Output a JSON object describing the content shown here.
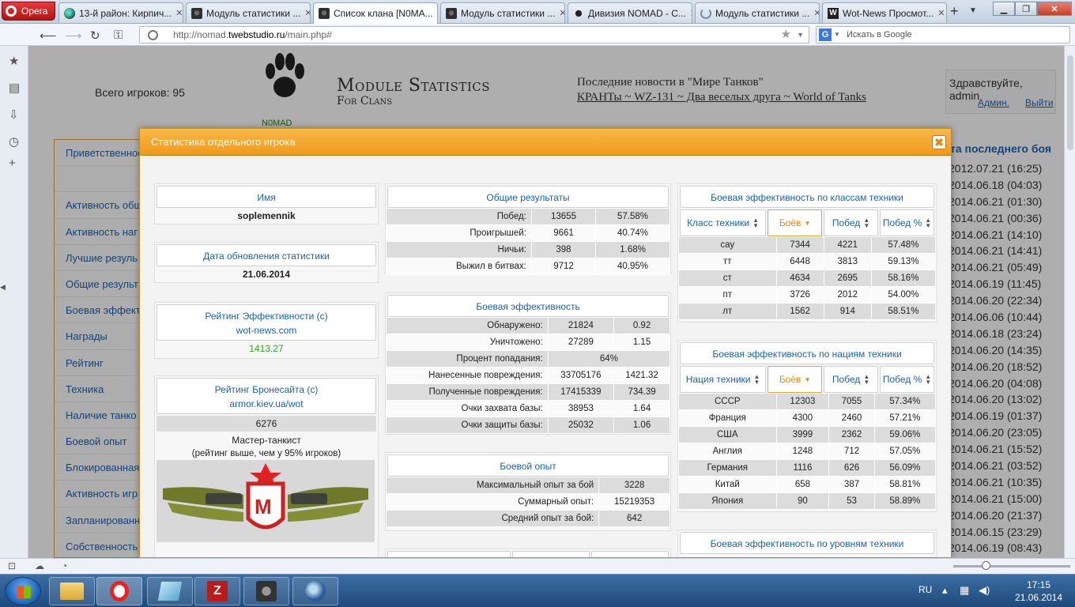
{
  "browser": {
    "menu_label": "Opera",
    "tabs": [
      {
        "title": "13-й район: Кирпич...",
        "icon": "globe-icon"
      },
      {
        "title": "Модуль статистики ...",
        "icon": "wot-icon"
      },
      {
        "title": "Список клана [N0MA...",
        "icon": "wot-icon",
        "active": true
      },
      {
        "title": "Модуль статистики ...",
        "icon": "wot-icon"
      },
      {
        "title": "Дивизия NOMAD - С...",
        "icon": "paw-icon"
      },
      {
        "title": "Модуль статистики ...",
        "icon": "loading-icon"
      },
      {
        "title": "Wot-News Просмот...",
        "icon": "w-icon"
      }
    ],
    "url_prefix": "http://nomad.",
    "url_domain": "twebstudio.ru",
    "url_path": "/main.php#",
    "search_placeholder": "Искать в Google",
    "search_engine": "G"
  },
  "page": {
    "players_total": "Всего игроков: 95",
    "logo_name": "N0MAD",
    "logo_title": "Module Statistics",
    "logo_sub": "For Clans",
    "news_heading": "Последние новости в \"Мире Танков\"",
    "news_links": "КРАНТы ~ WZ-131 ~ Два веселых друга ~ World of Tanks",
    "greeting": "Здравствуйте, admin",
    "admin_link": "Админ.",
    "logout_link": "Выйти",
    "last_battle_header": "та последнего боя",
    "menu": [
      "Приветственное",
      "",
      "Активность общ",
      "Активность наг",
      "Лучшие резуль",
      "Общие результ",
      "Боевая эффект",
      "Награды",
      "Рейтинг",
      "Техника",
      "Наличие танко",
      "Боевой опыт",
      "Блокированная",
      "Активность игр",
      "Запланированн",
      "Собственность"
    ],
    "dates": [
      "2012.07.21 (16:25)",
      "2014.06.18 (04:03)",
      "2014.06.21 (01:30)",
      "2014.06.21 (00:36)",
      "2014.06.21 (14:10)",
      "2014.06.21 (14:41)",
      "2014.06.21 (05:49)",
      "2014.06.19 (11:45)",
      "2014.06.20 (22:34)",
      "2014.06.06 (10:44)",
      "2014.06.18 (23:24)",
      "2014.06.20 (14:35)",
      "2014.06.20 (18:52)",
      "2014.06.20 (04:08)",
      "2014.06.20 (13:02)",
      "2014.06.19 (01:37)",
      "2014.06.20 (23:05)",
      "2014.06.21 (15:52)",
      "2014.06.21 (03:52)",
      "2014.06.21 (10:35)",
      "2014.06.21 (15:00)",
      "2014.06.20 (21:37)",
      "2014.06.15 (23:29)",
      "2014.06.19 (08:43)"
    ]
  },
  "modal": {
    "title": "Статистика отдельного игрока",
    "close_label": "✖",
    "name_header": "Имя",
    "name_value": "soplemennik",
    "updated_header": "Дата обновления статистики",
    "updated_value": "21.06.2014",
    "eff_rating_header": "Рейтинг Эффективности (с)",
    "eff_rating_link": "wot-news.com",
    "eff_rating_value": "1413.27",
    "armor_header": "Рейтинг Бронесайта (с)",
    "armor_link": "armor.kiev.ua/wot",
    "armor_value": "6276",
    "armor_title": "Мастер-танкист",
    "armor_note": "(рейтинг выше, чем у 95% игроков)",
    "medal_letter": "М",
    "general": {
      "header": "Общие результаты",
      "rows": [
        [
          "Побед:",
          "13655",
          "57.58%"
        ],
        [
          "Проигрышей:",
          "9661",
          "40.74%"
        ],
        [
          "Ничьи:",
          "398",
          "1.68%"
        ],
        [
          "Выжил в битвах:",
          "9712",
          "40.95%"
        ]
      ]
    },
    "battle_eff": {
      "header": "Боевая эффективность",
      "rows": [
        [
          "Обнаружено:",
          "21824",
          "0.92"
        ],
        [
          "Уничтожено:",
          "27289",
          "1.15"
        ],
        [
          "Процент попадания:",
          "64%",
          ""
        ],
        [
          "Нанесенные повреждения:",
          "33705176",
          "1421.32"
        ],
        [
          "Полученные повреждения:",
          "17415339",
          "734.39"
        ],
        [
          "Очки захвата базы:",
          "38953",
          "1.64"
        ],
        [
          "Очки защиты базы:",
          "25032",
          "1.06"
        ]
      ]
    },
    "experience": {
      "header": "Боевой опыт",
      "rows": [
        [
          "Максимальный опыт за бой",
          "3228"
        ],
        [
          "Суммарный опыт:",
          "15219353"
        ],
        [
          "Средний опыт за бой:",
          "642"
        ]
      ]
    },
    "rating_cols": [
      "Рейтинг",
      "Значение",
      "Место"
    ],
    "by_class": {
      "header": "Боевая эффективность по классам техники",
      "cols": [
        "Класс техники",
        "Боёв",
        "Побед",
        "Побед %"
      ],
      "rows": [
        [
          "сау",
          "7344",
          "4221",
          "57.48%"
        ],
        [
          "тт",
          "6448",
          "3813",
          "59.13%"
        ],
        [
          "ст",
          "4634",
          "2695",
          "58.16%"
        ],
        [
          "пт",
          "3726",
          "2012",
          "54.00%"
        ],
        [
          "лт",
          "1562",
          "914",
          "58.51%"
        ]
      ]
    },
    "by_nation": {
      "header": "Боевая эффективность по нациям техники",
      "cols": [
        "Нация техники",
        "Боёв",
        "Побед",
        "Побед %"
      ],
      "rows": [
        [
          "СССР",
          "12303",
          "7055",
          "57.34%"
        ],
        [
          "Франция",
          "4300",
          "2460",
          "57.21%"
        ],
        [
          "США",
          "3999",
          "2362",
          "59.06%"
        ],
        [
          "Англия",
          "1248",
          "712",
          "57.05%"
        ],
        [
          "Германия",
          "1116",
          "626",
          "56.09%"
        ],
        [
          "Китай",
          "658",
          "387",
          "58.81%"
        ],
        [
          "Япония",
          "90",
          "53",
          "58.89%"
        ]
      ]
    },
    "by_level_header": "Боевая эффективность по уровням техники"
  },
  "taskbar": {
    "lang": "RU",
    "time": "17:15",
    "date": "21.06.2014"
  },
  "colors": {
    "accent_orange": "#ef9a1c",
    "link_blue": "#1a62b0",
    "rating_green": "#3aa02a"
  }
}
